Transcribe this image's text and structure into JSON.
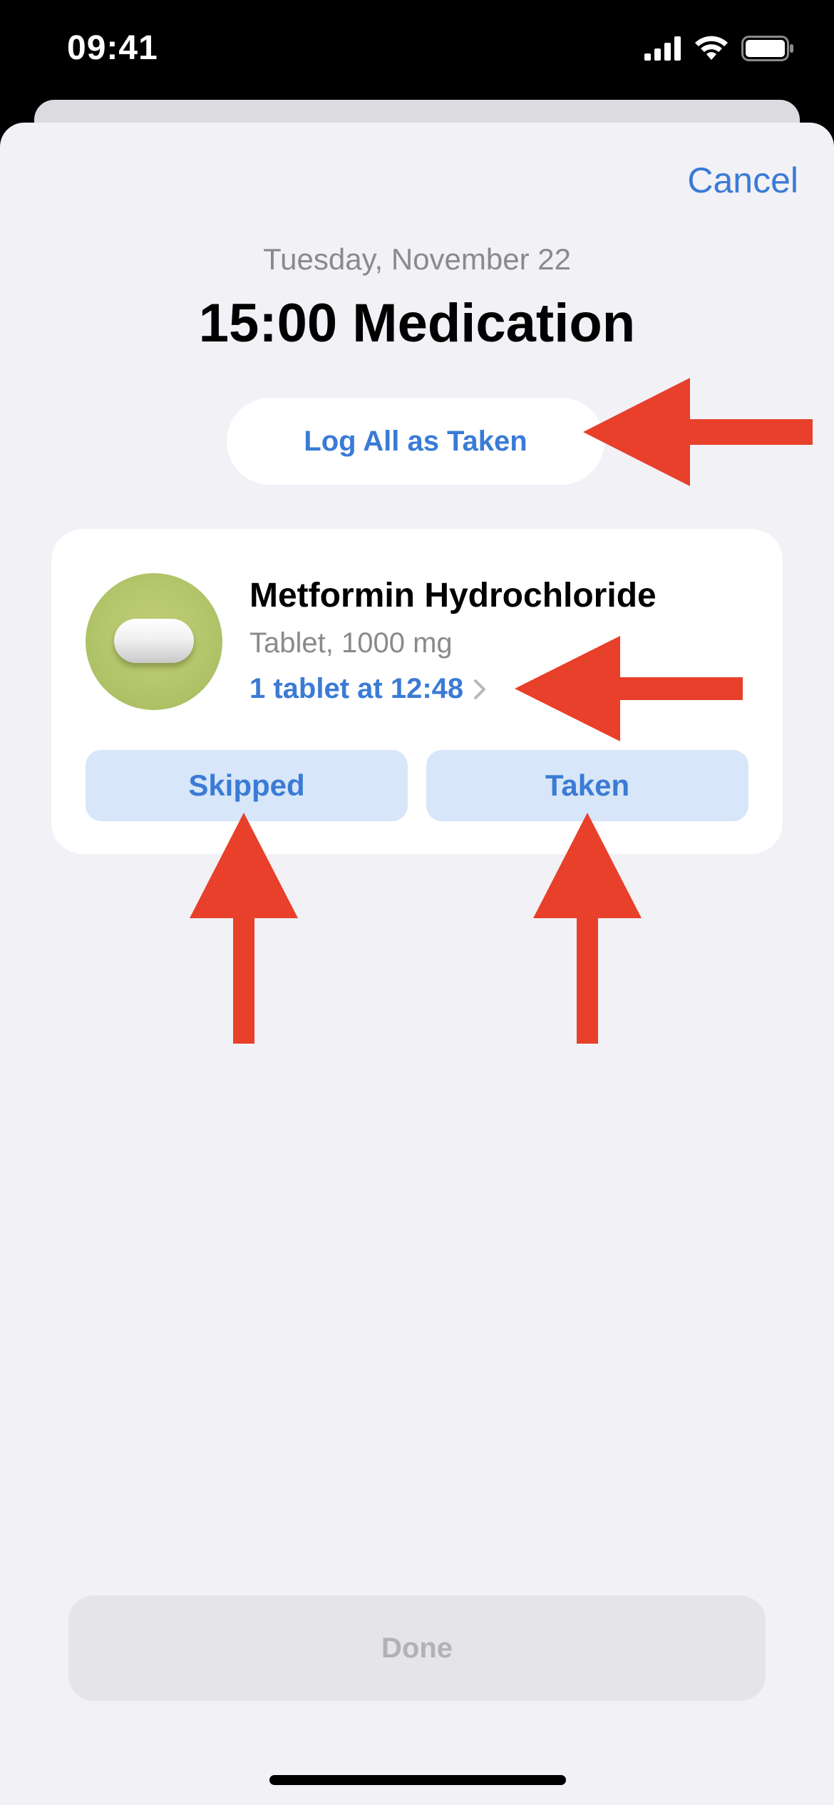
{
  "status_bar": {
    "time": "09:41"
  },
  "sheet": {
    "cancel_label": "Cancel",
    "date": "Tuesday, November 22",
    "title": "15:00 Medication",
    "log_all_label": "Log All as Taken"
  },
  "medication": {
    "name": "Metformin Hydrochloride",
    "form": "Tablet, 1000 mg",
    "dose": "1 tablet at 12:48",
    "skipped_label": "Skipped",
    "taken_label": "Taken"
  },
  "footer": {
    "done_label": "Done"
  },
  "colors": {
    "accent": "#3a7bd5",
    "background": "#f1f1f6",
    "card": "#ffffff",
    "button_fill": "#d7e6f8",
    "pill_circle": "#b3c56a",
    "annotation_arrow": "#e8402a",
    "done_disabled": "#e4e4e9"
  },
  "icons": {
    "signal": "cellular-signal-icon",
    "wifi": "wifi-icon",
    "battery": "battery-icon",
    "pill": "pill-icon",
    "chevron": "chevron-right-icon"
  }
}
